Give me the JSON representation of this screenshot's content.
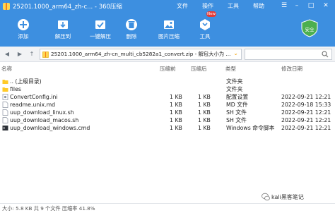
{
  "window": {
    "title": "25201.1000_arm64_zh-c... - 360压缩",
    "menus": [
      "文件",
      "操作",
      "工具",
      "帮助"
    ],
    "new_badge": "New"
  },
  "toolbar": {
    "items": [
      {
        "label": "添加",
        "icon": "add-icon"
      },
      {
        "label": "解压到",
        "icon": "extract-icon"
      },
      {
        "label": "一键解压",
        "icon": "one-click-extract-icon"
      },
      {
        "label": "删除",
        "icon": "delete-icon"
      },
      {
        "label": "图片压缩",
        "icon": "image-compress-icon"
      },
      {
        "label": "工具",
        "icon": "tools-icon"
      }
    ],
    "safety_label": "安全"
  },
  "address": {
    "path": "25201.1000_arm64_zh-cn_multi_cb5282a1_convert.zip - 解包大小为 ..."
  },
  "columns": [
    "名称",
    "压缩前",
    "压缩后",
    "类型",
    "修改日期"
  ],
  "files": [
    {
      "name": ".. (上级目录)",
      "before": "",
      "after": "",
      "type": "文件夹",
      "date": "",
      "icon": "folder"
    },
    {
      "name": "files",
      "before": "",
      "after": "",
      "type": "文件夹",
      "date": "",
      "icon": "folder"
    },
    {
      "name": "ConvertConfig.ini",
      "before": "1 KB",
      "after": "1 KB",
      "type": "配置设置",
      "date": "2022-09-21 12:21",
      "icon": "config"
    },
    {
      "name": "readme.unix.md",
      "before": "1 KB",
      "after": "1 KB",
      "type": "MD 文件",
      "date": "2022-09-18 15:33",
      "icon": "file"
    },
    {
      "name": "uup_download_linux.sh",
      "before": "1 KB",
      "after": "1 KB",
      "type": "SH 文件",
      "date": "2022-09-21 12:21",
      "icon": "file"
    },
    {
      "name": "uup_download_macos.sh",
      "before": "1 KB",
      "after": "1 KB",
      "type": "SH 文件",
      "date": "2022-09-21 12:21",
      "icon": "file"
    },
    {
      "name": "uup_download_windows.cmd",
      "before": "1 KB",
      "after": "1 KB",
      "type": "Windows 命令脚本",
      "date": "2022-09-21 12:21",
      "icon": "cmd"
    }
  ],
  "status": "大小: 5.8 KB 共 9 个文件 压缩率 41.8%",
  "watermark": "kali黑客笔记"
}
